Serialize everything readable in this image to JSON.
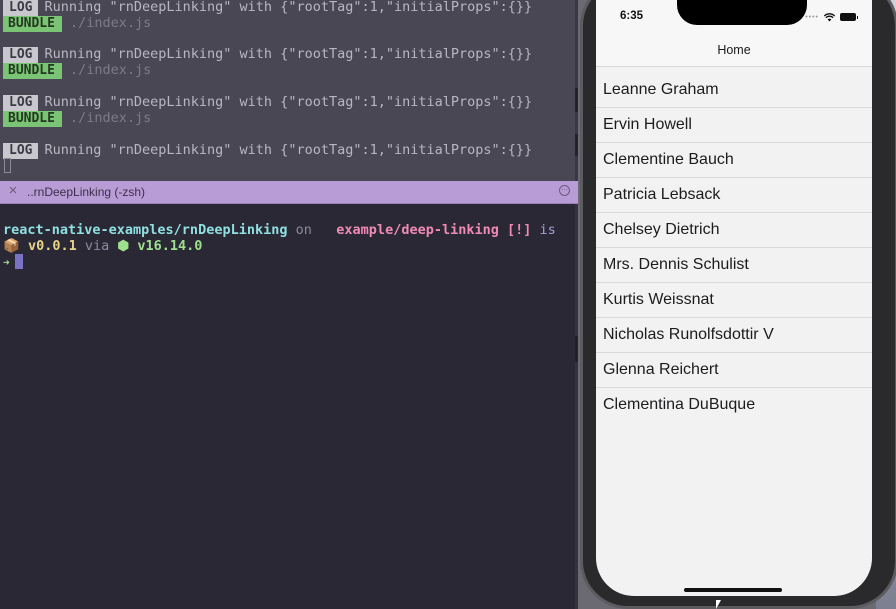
{
  "terminal": {
    "log_tag": "LOG",
    "bundle_tag": "BUNDLE",
    "log_message": "Running \"rnDeepLinking\" with {\"rootTag\":1,\"initialProps\":{}}",
    "bundle_path": "./index.js",
    "tab_title": "..rnDeepLinking (-zsh)",
    "tab_close": "×",
    "tab_more": "···",
    "prompt": {
      "path": "react-native-examples/rnDeepLinking",
      "on": "on",
      "branch_icon": "",
      "branch": "example/deep-linking",
      "status": "[!]",
      "is": "is",
      "package_icon": "📦",
      "version": "v0.0.1",
      "via": "via",
      "node_icon": "⬢",
      "node_version": "v16.14.0",
      "arrow": "➜"
    }
  },
  "phone": {
    "time": "6:35",
    "nav_title": "Home",
    "users": [
      "Leanne Graham",
      "Ervin Howell",
      "Clementine Bauch",
      "Patricia Lebsack",
      "Chelsey Dietrich",
      "Mrs. Dennis Schulist",
      "Kurtis Weissnat",
      "Nicholas Runolfsdottir V",
      "Glenna Reichert",
      "Clementina DuBuque"
    ]
  }
}
